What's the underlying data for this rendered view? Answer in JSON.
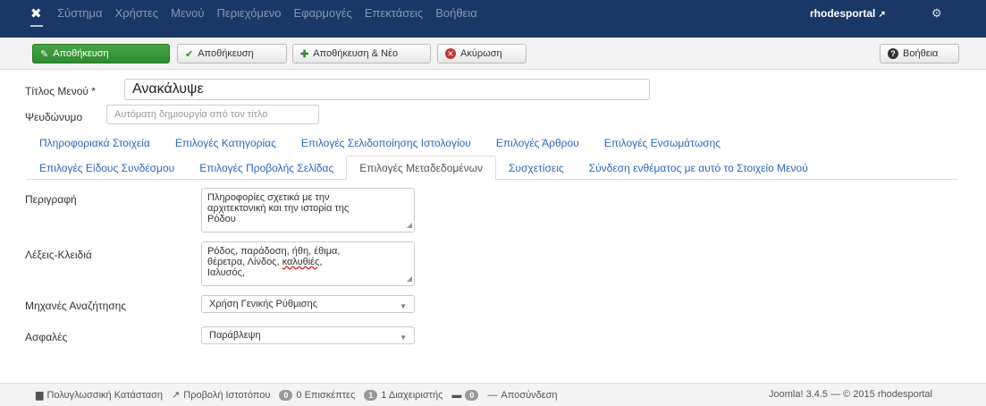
{
  "navbar": {
    "logo_icon": "joomla-icon",
    "menu": [
      "Σύστημα",
      "Χρήστες",
      "Μενού",
      "Περιεχόμενο",
      "Εφαρμογές",
      "Επεκτάσεις",
      "Βοήθεια"
    ],
    "site_label": "rhodesportal",
    "bg_color": "#1a3867"
  },
  "toolbar": {
    "save_label": "Αποθήκευση",
    "save_close_label": "Αποθήκευση",
    "save_new_label": "Αποθήκευση & Νέο",
    "cancel_label": "Ακύρωση",
    "help_label": "Βοήθεια"
  },
  "form": {
    "title_label": "Τίτλος Μενού *",
    "title_value": "Ανακάλυψε",
    "alias_label": "Ψευδώνυμο",
    "alias_placeholder": "Αυτόματη δημιουργία από τον τίτλο"
  },
  "tabs_row1": [
    "Πληροφοριακά Στοιχεία",
    "Επιλογές Κατηγορίας",
    "Επιλογές Σελιδοποίησης Ιστολογίου",
    "Επιλογές Άρθρου",
    "Επιλογές Ενσωμάτωσης"
  ],
  "tabs_row2": [
    "Επιλογές Είδους Συνδέσμου",
    "Επιλογές Προβολής Σελίδας",
    "Επιλογές Μεταδεδομένων",
    "Συσχετίσεις",
    "Σύνδεση ενθέματος με αυτό το Στοιχείο Μενού"
  ],
  "meta": {
    "description_label": "Περιγραφή",
    "description_lines": [
      "Πληροφορίες σχετικά με την",
      "αρχιτεκτονική και την ιστορία της",
      "Ρόδου"
    ],
    "keywords_label": "Λέξεις-Κλειδιά",
    "keywords_line1": "Ρόδος, παράδοση, ήθη, έθιμα,",
    "keywords_line2_a": "θέρετρα, Λίνδος, ",
    "keywords_line2_b": "καλυθιές",
    "keywords_line2_c": ",",
    "keywords_line3": "Ιαλυσός,",
    "robots_label": "Μηχανές Αναζήτησης",
    "robots_value": "Χρήση Γενικής Ρύθμισης",
    "secure_label": "Ασφαλές",
    "secure_value": "Παράβλεψη"
  },
  "statusbar": {
    "multilang": "Πολυγλωσσική Κατάσταση",
    "view_site": "Προβολή Ιστοτόπου",
    "visitors_count": "0",
    "visitors": "0 Επισκέπτες",
    "admins_count": "1",
    "admins": "1 Διαχειριστής",
    "msg_count": "0",
    "logout": "Αποσύνδεση",
    "version": "Joomla! 3.4.5 — © 2015 rhodesportal"
  }
}
